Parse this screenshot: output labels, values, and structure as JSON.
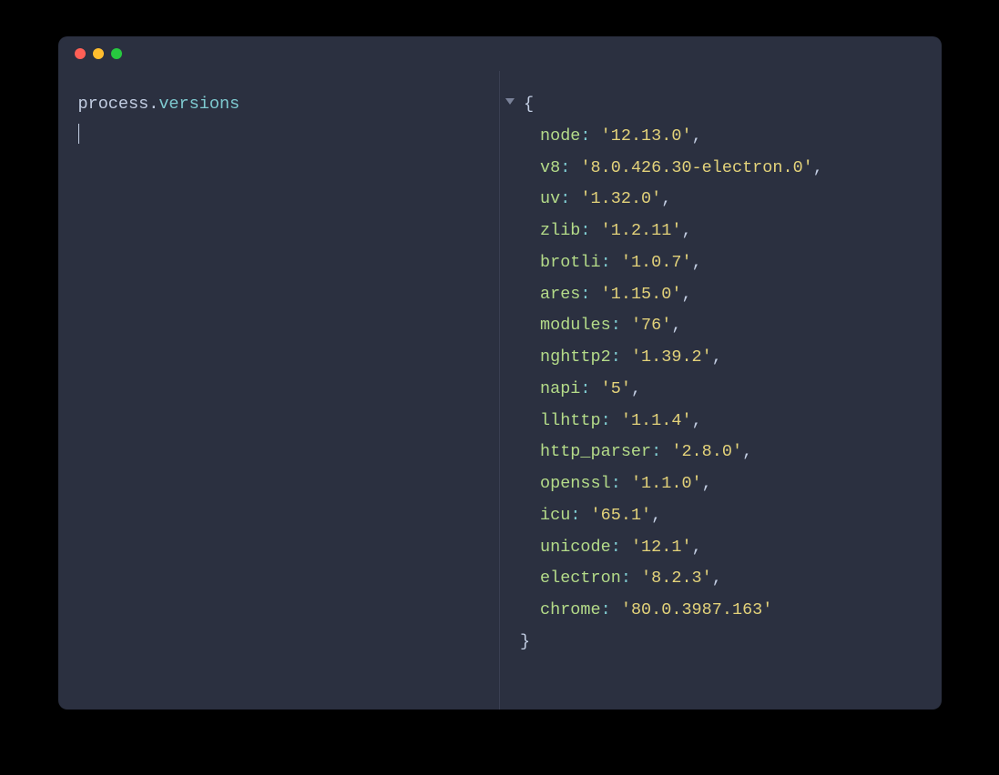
{
  "input": {
    "object": "process",
    "property": "versions"
  },
  "output": {
    "entries": [
      {
        "key": "node",
        "value": "'12.13.0'"
      },
      {
        "key": "v8",
        "value": "'8.0.426.30-electron.0'"
      },
      {
        "key": "uv",
        "value": "'1.32.0'"
      },
      {
        "key": "zlib",
        "value": "'1.2.11'"
      },
      {
        "key": "brotli",
        "value": "'1.0.7'"
      },
      {
        "key": "ares",
        "value": "'1.15.0'"
      },
      {
        "key": "modules",
        "value": "'76'"
      },
      {
        "key": "nghttp2",
        "value": "'1.39.2'"
      },
      {
        "key": "napi",
        "value": "'5'"
      },
      {
        "key": "llhttp",
        "value": "'1.1.4'"
      },
      {
        "key": "http_parser",
        "value": "'2.8.0'"
      },
      {
        "key": "openssl",
        "value": "'1.1.0'"
      },
      {
        "key": "icu",
        "value": "'65.1'"
      },
      {
        "key": "unicode",
        "value": "'12.1'"
      },
      {
        "key": "electron",
        "value": "'8.2.3'"
      },
      {
        "key": "chrome",
        "value": "'80.0.3987.163'"
      }
    ]
  }
}
